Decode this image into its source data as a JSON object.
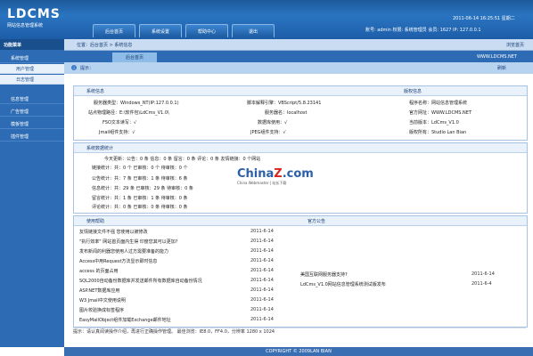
{
  "header": {
    "logo": "LDCMS",
    "logo_sub": "网站信息管理系统",
    "date": "2011-06-14 16:25:51 星期二",
    "user_info": "账号: admin 权限: 系统管理员 会员: 1627 IP: 127.0.0.1",
    "tabs": [
      "后台首页",
      "系统设置",
      "帮助中心",
      "退出"
    ]
  },
  "sidebar": {
    "title": "功能菜单",
    "items": [
      "系统管理",
      "用户管理",
      "日志管理",
      "信息管理",
      "广告管理",
      "模板管理",
      "插件管理"
    ]
  },
  "breadcrumb": {
    "text": "位置：后台首页 > 系统信息",
    "right": "浏览首页"
  },
  "content_tab": {
    "label": "后台首页",
    "right": "WWW.LDCMS.NET"
  },
  "hint": {
    "icon": "i",
    "label": "提示：",
    "right": "刷新"
  },
  "sysinfo": {
    "title": "系统信息",
    "copyright_title": "版权信息",
    "left": [
      "服务器类型：Windows_NT(IP:127.0.0.1)",
      "站点物理路径：E:\\软件包\\LdCms_V1.0\\",
      "FSO文本读写：√",
      "Jmail组件支持：√"
    ],
    "middle": [
      "脚本解释引擎：VBScript/5.8.23141",
      "服务器名：localhost",
      "数据库使用：√",
      "JPEG组件支持：√"
    ],
    "right": [
      "程序名称：网站信息管理系统",
      "官方网址：WWW.LDCMS.NET",
      "当前版本：LdCms_V1.0",
      "版权所有：Studio Lan Bian"
    ]
  },
  "stats": {
    "title": "系统数据统计",
    "lines": [
      "今天更新：公告：0 条 信息：0 条 留言：0 条 评论：0 条 友情链接：0 个网站",
      "链接统计：共：0 个 已审核：0 个 待审核：0 个",
      "公告统计：共：7 条 已审核：1 条 待审核：6 条",
      "信息统计：共：29 条 已审核：29 条 待审核：0 条",
      "留言统计：共：1 条 已审核：1 条 待审核：0 条",
      "评论统计：共：0 条 已审核：0 条 待审核：0 条"
    ]
  },
  "watermark": {
    "brand": "China",
    "brand_suffix": "Z",
    "brand_tail": ".com",
    "sub": "China Webmaster | 站长下载"
  },
  "help": {
    "title": "使用帮助",
    "items": [
      {
        "text": "友情链接文件不强 您使用以被修改",
        "date": "2011-6-14"
      },
      {
        "text": "\"执行效率\" 网站首页面内生得 印度您其可以更加?",
        "date": "2011-6-14"
      },
      {
        "text": "发布新闻的利器您使用人过方需要准备的能力",
        "date": "2011-6-14"
      },
      {
        "text": "Access中用Request方法显示即时信息",
        "date": "2011-6-14"
      },
      {
        "text": "access 的页面占用",
        "date": "2011-6-14"
      },
      {
        "text": "SQL2000自动备份数据库并发送邮件所有数据库自动备份情况",
        "date": "2011-6-14"
      },
      {
        "text": "ASP.NET数据库应用",
        "date": "2011-6-14"
      },
      {
        "text": "W3 Jmail中文使用说明",
        "date": "2011-6-14"
      },
      {
        "text": "图片校验换成标签程序",
        "date": "2011-6-14"
      },
      {
        "text": "EasyMailObject组件加载Exchange邮件地址",
        "date": "2011-6-14"
      }
    ]
  },
  "announce": {
    "title": "官方公告",
    "items": [
      {
        "text": "美国互联网服务器支持?",
        "date": "2011-6-14"
      },
      {
        "text": "LdCms_V1.0网站信息管理系统测试版发布",
        "date": "2011-6-4"
      }
    ]
  },
  "tip": "提示：请认真阅读操作介绍，再进行正确操作管理。 最佳浏览：IE8.0，FF4.0，分辨率 1280 x 1024",
  "footer": "COPYRIGHT © 2009LAN BIAN"
}
